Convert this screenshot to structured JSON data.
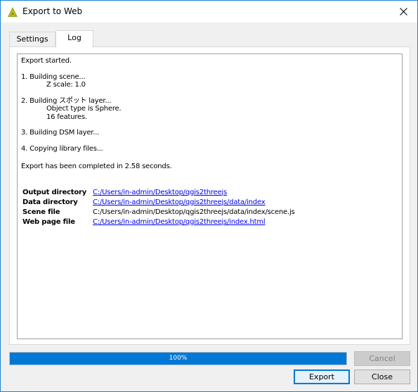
{
  "window": {
    "title": "Export to Web",
    "close_glyph": "✕",
    "app_icon": "qgis-logo-icon"
  },
  "tabs": [
    {
      "label": "Settings",
      "active": false
    },
    {
      "label": "Log",
      "active": true
    }
  ],
  "log": {
    "lines": [
      "Export started.",
      "1. Building scene...",
      "Z scale: 1.0",
      "2. Building スポット layer...",
      "Object type is Sphere.",
      "16 features.",
      "3. Building DSM layer...",
      "4. Copying library files...",
      "Export has been completed in 2.58 seconds."
    ],
    "info": [
      {
        "key": "Output directory",
        "value": "C:/Users/in-admin/Desktop/qgis2threejs",
        "is_link": true
      },
      {
        "key": "Data directory",
        "value": "C:/Users/in-admin/Desktop/qgis2threejs/data/index",
        "is_link": true
      },
      {
        "key": "Scene file",
        "value": "C:/Users/in-admin/Desktop/qgis2threejs/data/index/scene.js",
        "is_link": false
      },
      {
        "key": "Web page file",
        "value": "C:/Users/in-admin/Desktop/qgis2threejs/index.html",
        "is_link": true
      }
    ]
  },
  "progress": {
    "value": 1.0,
    "label": "100%",
    "color": "#0078d7"
  },
  "buttons": {
    "cancel": "Cancel",
    "export": "Export",
    "close": "Close"
  }
}
